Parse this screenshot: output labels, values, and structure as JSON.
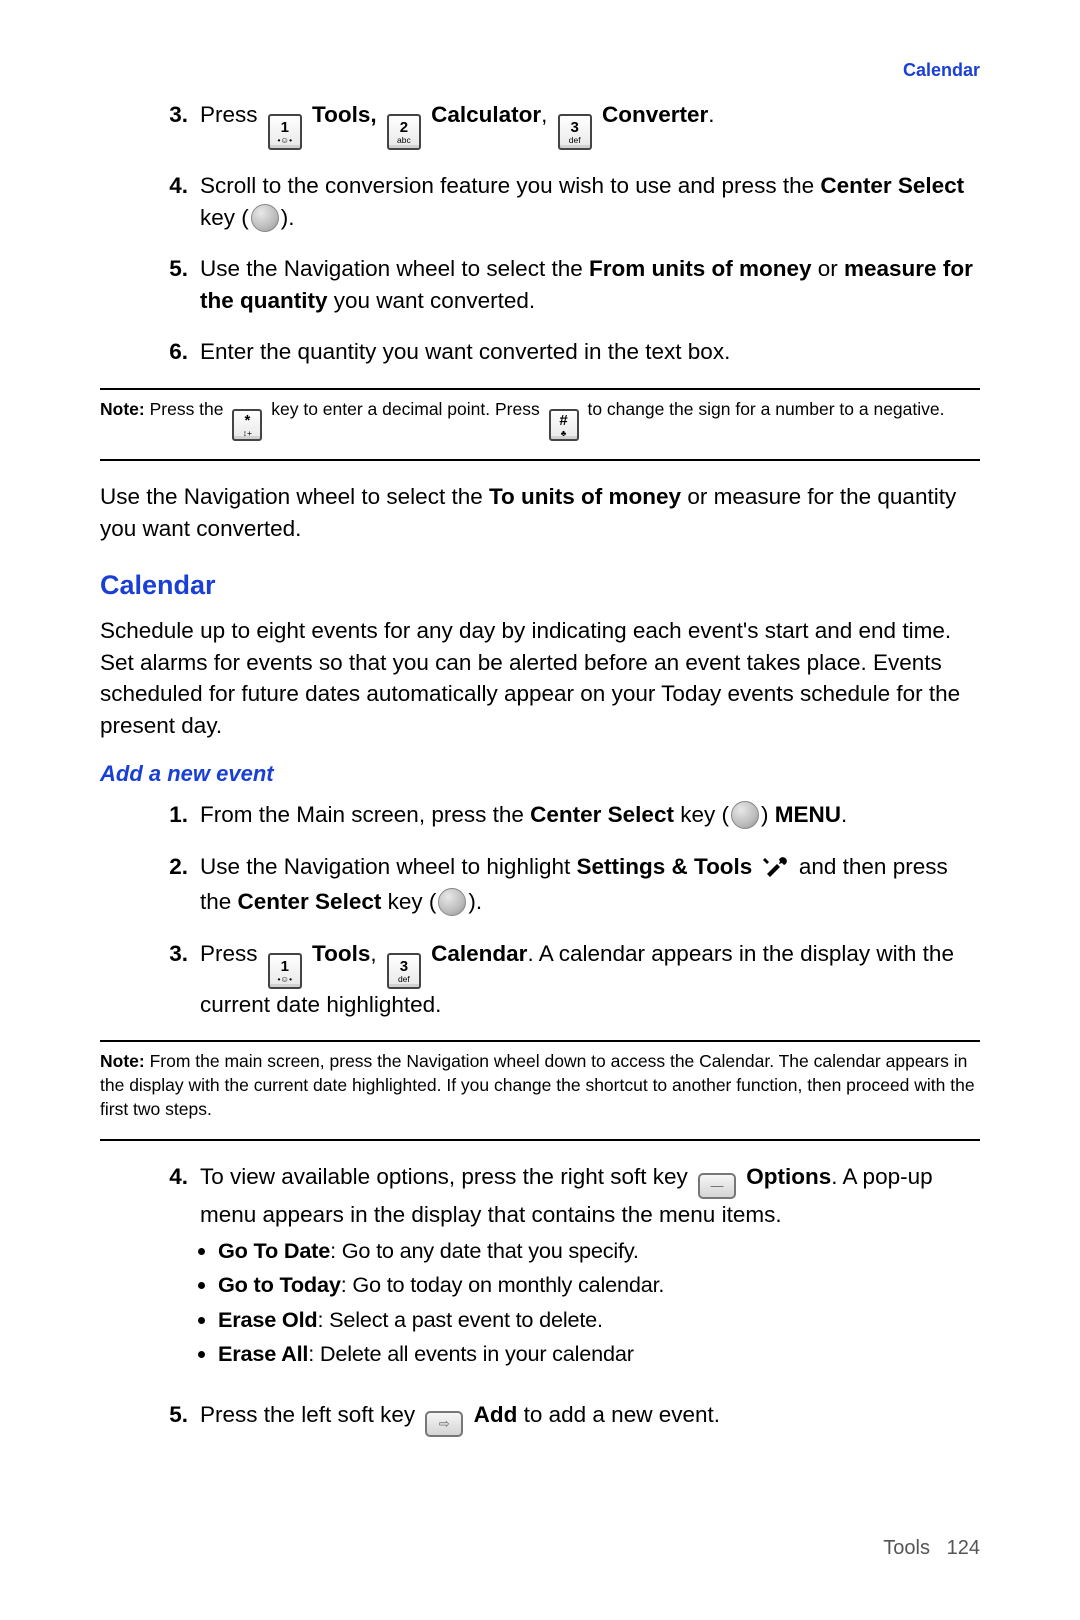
{
  "header": {
    "sectionLink": "Calendar"
  },
  "keys": {
    "k1num": "1",
    "k1sub": "•☺•",
    "k2num": "2",
    "k2sub": "abc",
    "k3num": "3",
    "k3sub": "def",
    "star": "*",
    "starSub": "↕+",
    "hash": "#",
    "hashSub": "♣",
    "softDash": "—",
    "softArrow": "⇨"
  },
  "steps1": {
    "s3": {
      "num": "3.",
      "pre": "Press ",
      "tools": "Tools,",
      "calc": "Calculator",
      "conv": "Converter",
      "sep": ", ",
      "end": "."
    },
    "s4": {
      "num": "4.",
      "t1": "Scroll to the conversion feature you wish to use and press the ",
      "bCenterSelect": "Center Select",
      "t2": " key (",
      "t3": ")."
    },
    "s5": {
      "num": "5.",
      "t1": "Use the Navigation wheel to select the ",
      "b1": "From units of money",
      "t2": " or ",
      "b2": "measure for the quantity",
      "t3": " you want converted."
    },
    "s6": {
      "num": "6.",
      "t1": "Enter the quantity you want converted in the text box."
    }
  },
  "note1": {
    "label": "Note:",
    "t1": " Press the ",
    "t2": " key to enter a decimal point. Press ",
    "t3": " to change the sign for a number to a negative."
  },
  "converterPara": {
    "t1": "Use the Navigation wheel to select the ",
    "b1": "To units of money",
    "t2": " or measure for the quantity you want converted."
  },
  "calendar": {
    "heading": "Calendar",
    "para": "Schedule up to eight events for any day by indicating each event's start and end time. Set alarms for events so that you can be alerted before an event takes place. Events scheduled for future dates automatically appear on your Today events schedule for the present day.",
    "addHeading": "Add a new event"
  },
  "steps2": {
    "s1": {
      "num": "1.",
      "t1": "From the Main screen, press the ",
      "b1": "Center Select",
      "t2": " key (",
      "t3": ") ",
      "b2": "MENU",
      "t4": "."
    },
    "s2": {
      "num": "2.",
      "t1": "Use the Navigation wheel to highlight ",
      "b1": "Settings & Tools",
      "t2": " and then press the ",
      "b2": "Center Select",
      "t3": " key (",
      "t4": ")."
    },
    "s3": {
      "num": "3.",
      "t1": "Press ",
      "b1": "Tools",
      "sep": ", ",
      "b2": "Calendar",
      "t2": ". A calendar appears in the display with the current date highlighted."
    }
  },
  "note2": {
    "label": "Note:",
    "t1": " From the main screen, press the Navigation wheel down to access the Calendar. The calendar appears in the display with the current date highlighted. If you change the shortcut to another function, then proceed with the first two steps."
  },
  "steps3": {
    "s4": {
      "num": "4.",
      "t1": "To view available options, press the right soft key ",
      "b1": "Options",
      "t2": ". A pop-up menu appears in the display that contains the menu items."
    },
    "bullets": [
      {
        "b": "Go To Date",
        "t": ": Go to any date that you specify."
      },
      {
        "b": "Go to Today",
        "t": ": Go to today on monthly calendar."
      },
      {
        "b": "Erase Old",
        "t": ": Select a past event to delete."
      },
      {
        "b": "Erase All",
        "t": ": Delete all events in your calendar"
      }
    ],
    "s5": {
      "num": "5.",
      "t1": "Press the left soft key ",
      "b1": "Add",
      "t2": " to add a new event."
    }
  },
  "footer": {
    "section": "Tools",
    "page": "124"
  }
}
